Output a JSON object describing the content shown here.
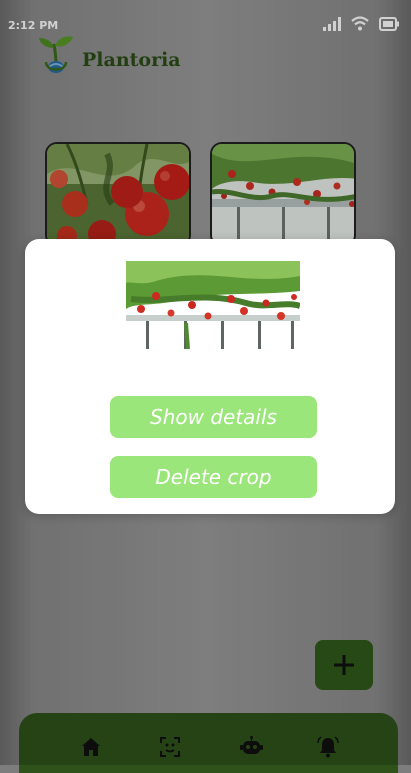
{
  "status_bar": {
    "time": "2:12 PM"
  },
  "app": {
    "name": "Plantoria"
  },
  "crops": [
    {
      "name": "tomato",
      "image": "tomato-plant-image"
    },
    {
      "name": "strawberry",
      "image": "strawberry-greenhouse-image"
    }
  ],
  "modal": {
    "image": "strawberry-greenhouse-image",
    "show_details_label": "Show details",
    "delete_crop_label": "Delete crop"
  },
  "fab": {
    "icon": "plus-icon"
  },
  "bottom_nav": {
    "items": [
      {
        "icon": "home-icon"
      },
      {
        "icon": "scan-face-icon"
      },
      {
        "icon": "robot-icon"
      },
      {
        "icon": "bell-icon"
      }
    ]
  },
  "colors": {
    "brand_dark_green": "#2e5219",
    "button_green": "#9be67a",
    "logo_text": "#2b4e16"
  }
}
